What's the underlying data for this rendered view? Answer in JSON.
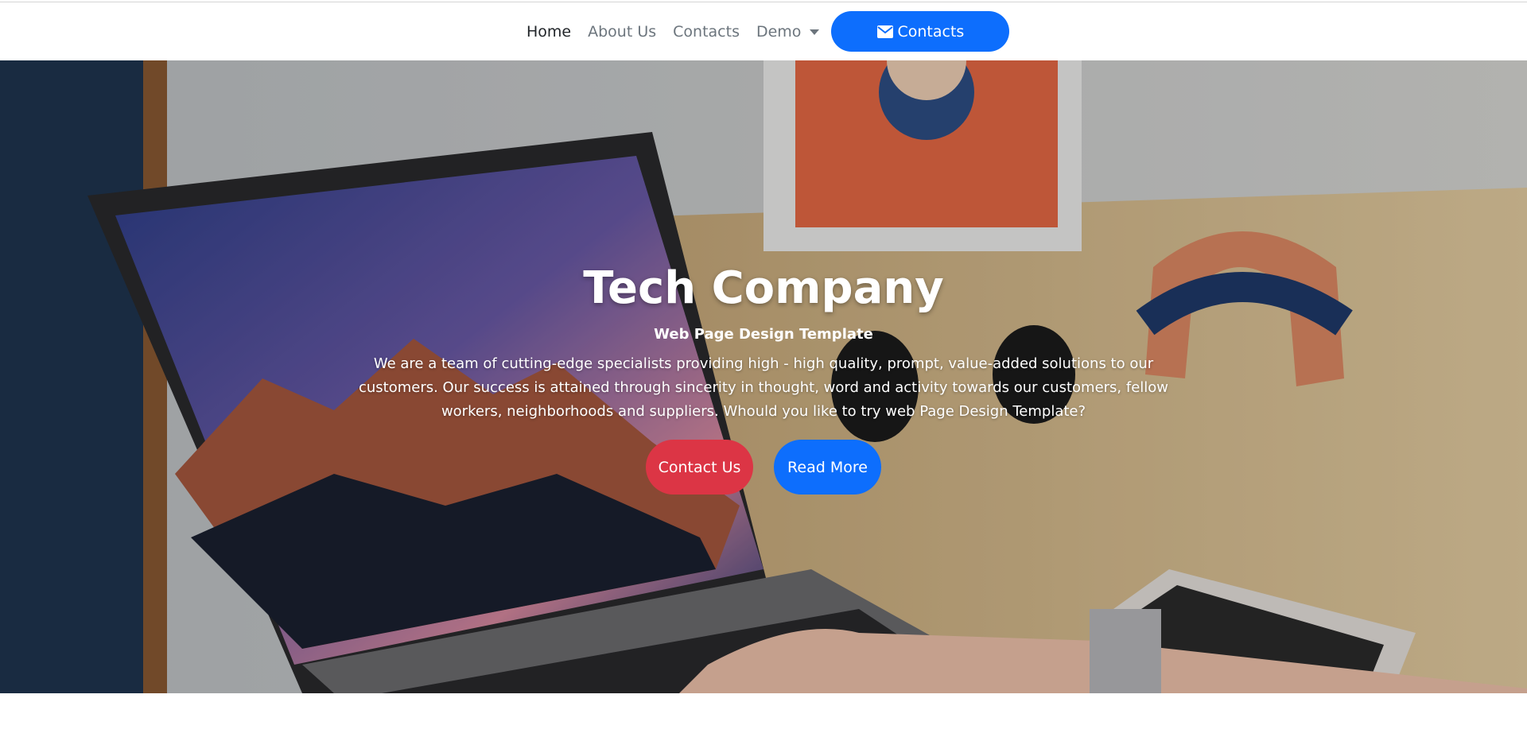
{
  "navbar": {
    "items": [
      {
        "label": "Home",
        "active": true
      },
      {
        "label": "About Us",
        "active": false
      },
      {
        "label": "Contacts",
        "active": false
      }
    ],
    "dropdown": {
      "label": "Demo"
    },
    "cta": {
      "label": "Contacts",
      "icon": "envelope-icon"
    }
  },
  "hero": {
    "title": "Tech Company",
    "subtitle": "Web Page Design Template",
    "text": "We are a team of cutting-edge specialists providing high - high quality, prompt, value-added solutions to our customers. Our success is attained through sincerity in thought, word and activity towards our customers, fellow workers, neighborhoods and suppliers. Whould you like to try web Page Design Template?",
    "buttons": {
      "contact": "Contact Us",
      "read_more": "Read More"
    }
  },
  "colors": {
    "primary": "#0d6efd",
    "danger": "#dc3545",
    "nav_text": "#6c757d",
    "nav_active": "#212529"
  }
}
